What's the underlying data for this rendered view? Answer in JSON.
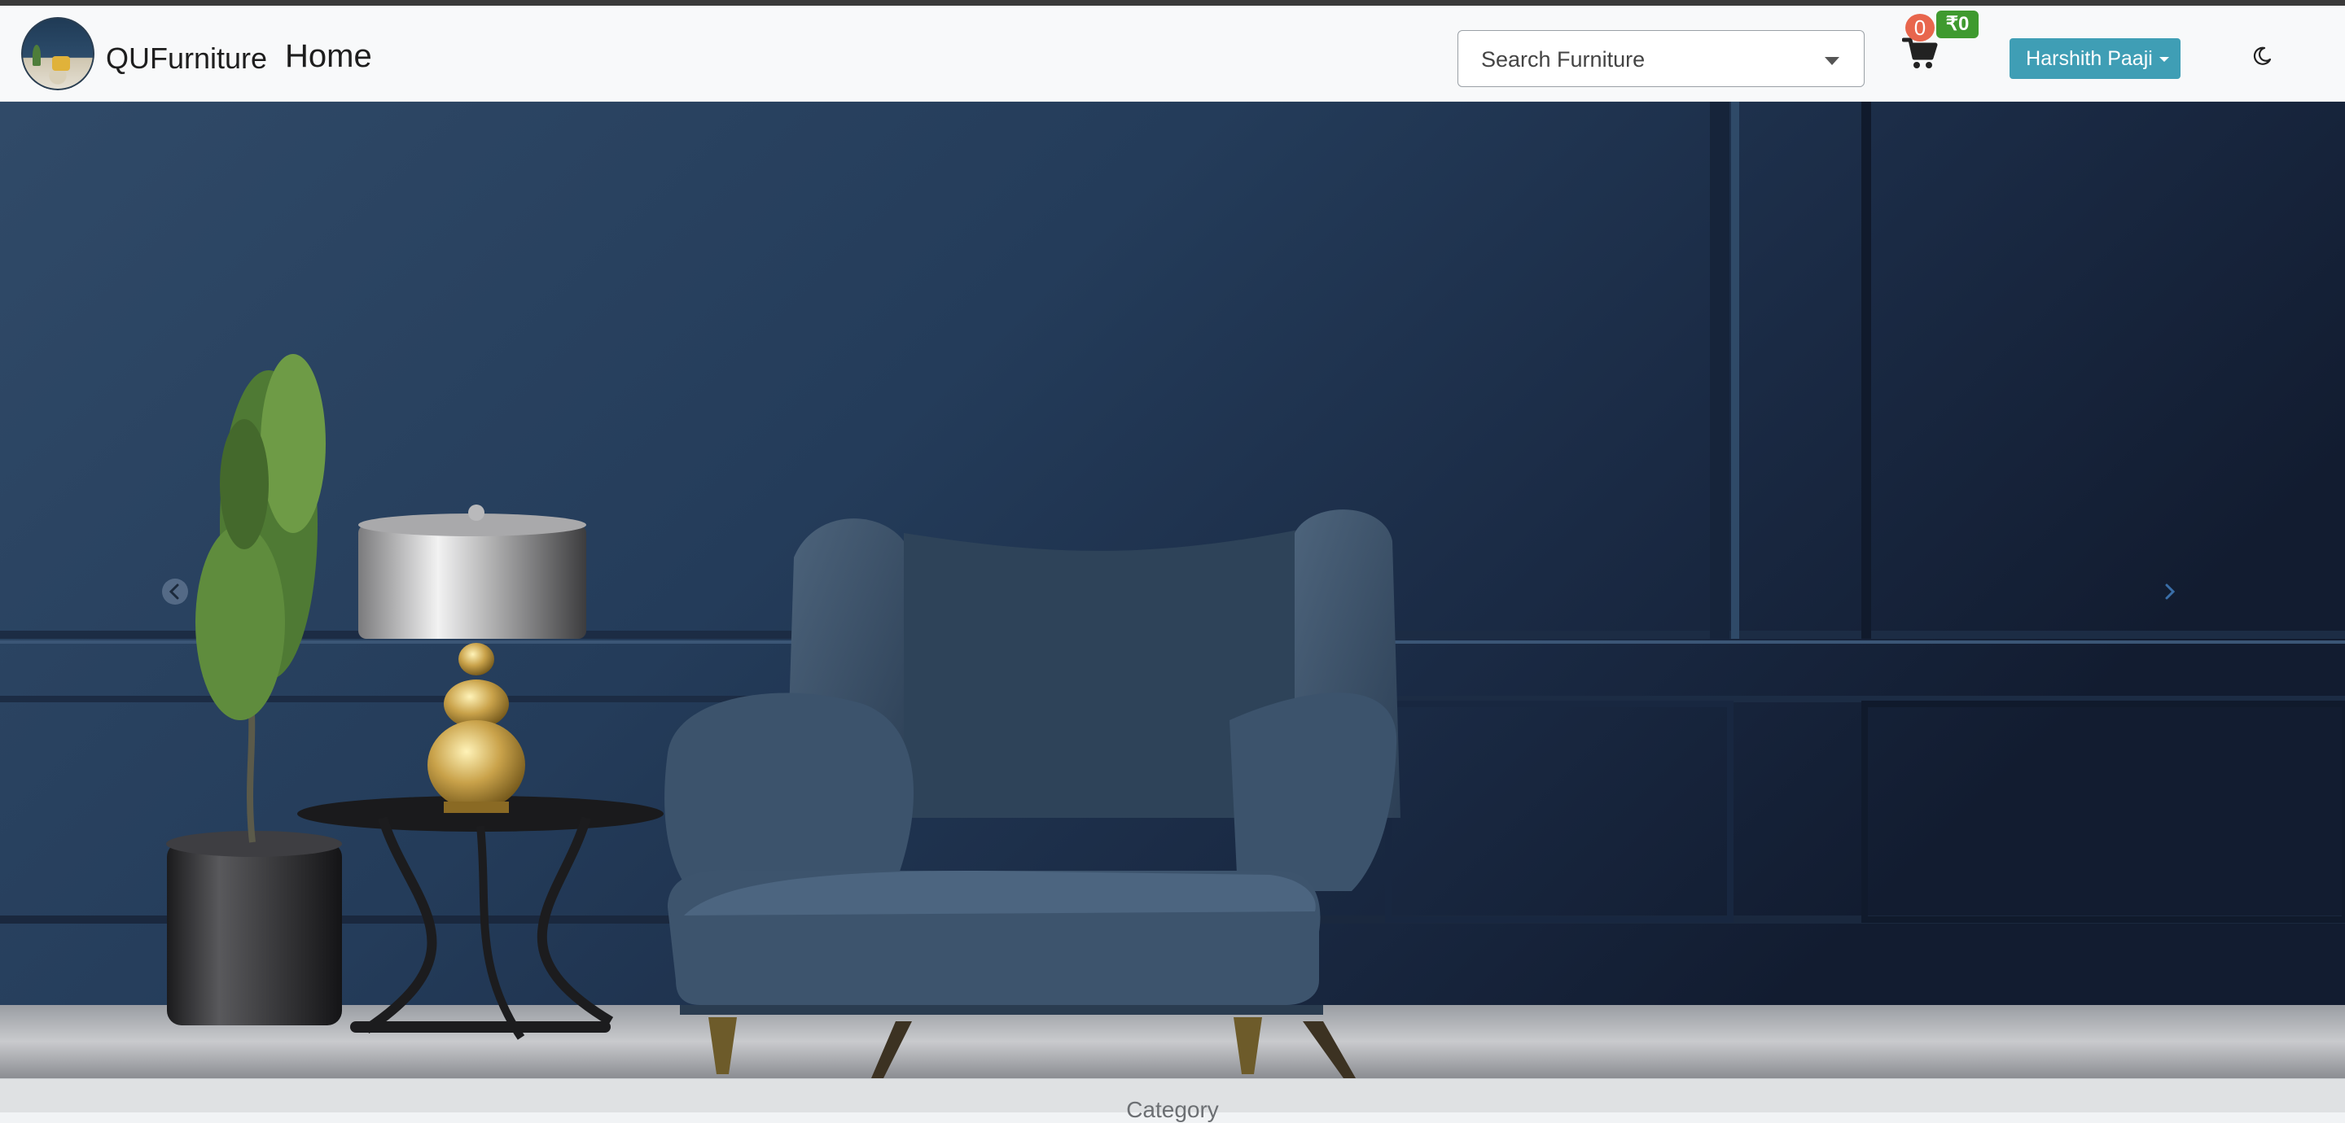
{
  "navbar": {
    "brand": "QUFurniture",
    "home_link": "Home",
    "search": {
      "placeholder": "Search Furniture"
    },
    "cart": {
      "count": "0",
      "total": "₹0"
    },
    "user_menu": "Harshith Paaji",
    "theme_toggle_icon": "moon-icon",
    "logo_icon": "furniture-logo-icon"
  },
  "hero": {
    "image": "velvet-armchair-blue-room",
    "prev_icon": "chevron-left-icon",
    "next_icon": "chevron-right-icon"
  },
  "section": {
    "title": "Category"
  },
  "colors": {
    "navbar_bg": "#f8f9fa",
    "user_button": "#3f9eb5",
    "cart_count_badge": "#e8664d",
    "cart_total_badge": "#3f9a2f",
    "hero_wall": "#1e3450"
  }
}
